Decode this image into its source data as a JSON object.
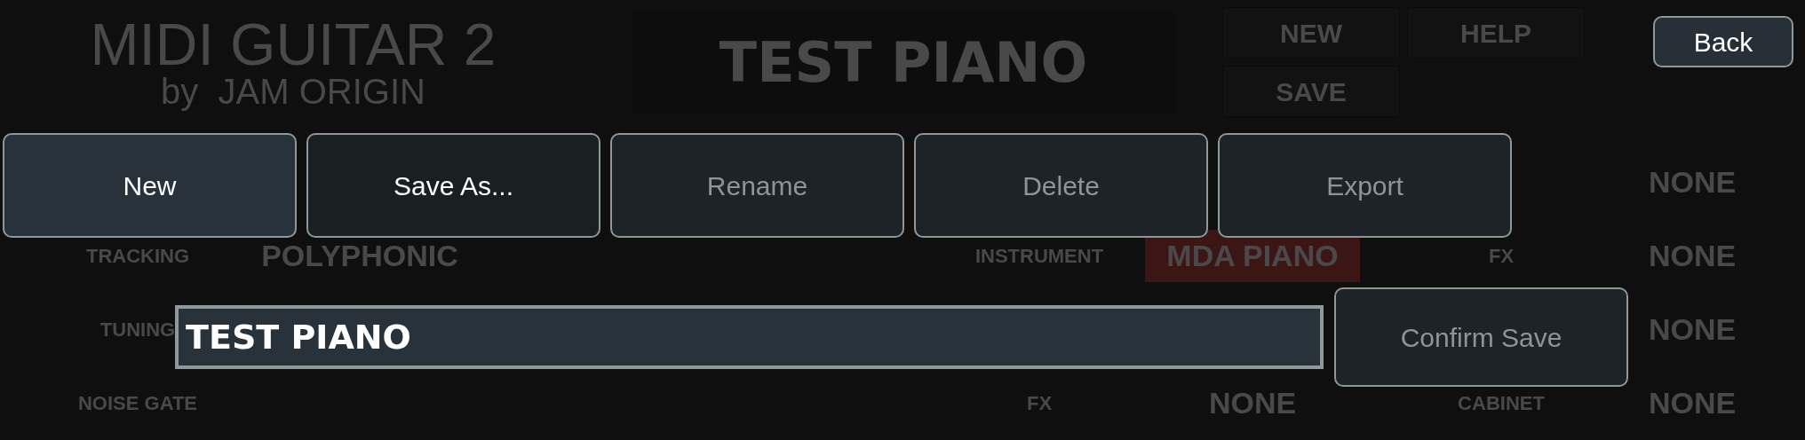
{
  "background": {
    "logo": {
      "title": "MIDI GUITAR 2",
      "subtitle": "by  JAM ORIGIN"
    },
    "preset_title": "TEST PIANO",
    "menu_buttons": [
      {
        "label": "NEW"
      },
      {
        "label": "HELP"
      },
      {
        "label": "SAVE"
      }
    ],
    "tracking_panel": [
      {
        "label": "TRACKING",
        "value": "POLYPHONIC"
      },
      {
        "label": "TUNING"
      },
      {
        "label": "NOISE GATE"
      }
    ],
    "instrument_panel": [
      {
        "label": "INSTRUMENT",
        "value": "MDA PIANO",
        "active": true
      },
      {
        "label": "FX",
        "value": "NONE",
        "active": false
      }
    ],
    "effects_panel": [
      {
        "value": "NONE"
      },
      {
        "label": "FX",
        "value": "NONE"
      },
      {
        "value": "NONE"
      },
      {
        "label": "CABINET",
        "value": "NONE"
      }
    ]
  },
  "dialog": {
    "back_button": "Back",
    "actions": [
      {
        "label": "New",
        "selected": true,
        "disabled": false
      },
      {
        "label": "Save As...",
        "selected": false,
        "disabled": false
      },
      {
        "label": "Rename",
        "selected": false,
        "disabled": true
      },
      {
        "label": "Delete",
        "selected": false,
        "disabled": true
      },
      {
        "label": "Export",
        "selected": false,
        "disabled": true
      }
    ],
    "name_field": {
      "value": "TEST PIANO"
    },
    "confirm_button": {
      "label": "Confirm Save",
      "disabled": true
    }
  }
}
